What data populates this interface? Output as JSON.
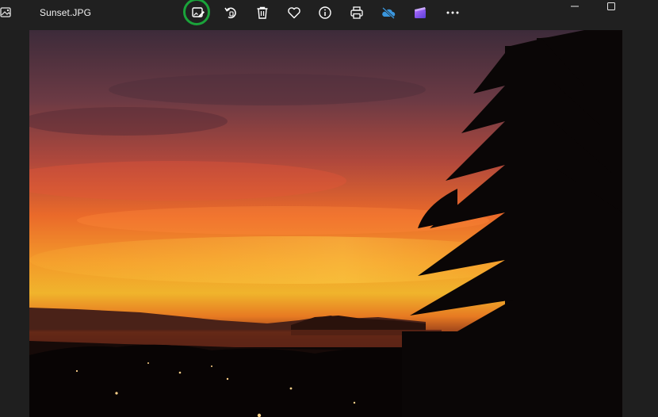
{
  "window": {
    "title": "Sunset.JPG",
    "app_icon": "photos-app-icon"
  },
  "toolbar": {
    "items": [
      {
        "name": "edit-image",
        "icon": "edit-image-icon",
        "highlighted": true
      },
      {
        "name": "rotate",
        "icon": "rotate-icon"
      },
      {
        "name": "delete",
        "icon": "trash-icon"
      },
      {
        "name": "favorite",
        "icon": "heart-icon"
      },
      {
        "name": "info",
        "icon": "info-icon"
      },
      {
        "name": "print",
        "icon": "printer-icon"
      },
      {
        "name": "onedrive",
        "icon": "onedrive-cloud-icon"
      },
      {
        "name": "clipchamp",
        "icon": "clipchamp-icon"
      },
      {
        "name": "more",
        "icon": "more-dots-icon"
      }
    ],
    "highlight_color": "#1aa33a"
  },
  "window_controls": [
    "minimize",
    "maximize"
  ],
  "image": {
    "subject": "sunset-photo"
  },
  "colors": {
    "background": "#202020",
    "onedrive": "#3a96dd",
    "clipchamp": "#7c5cff"
  }
}
